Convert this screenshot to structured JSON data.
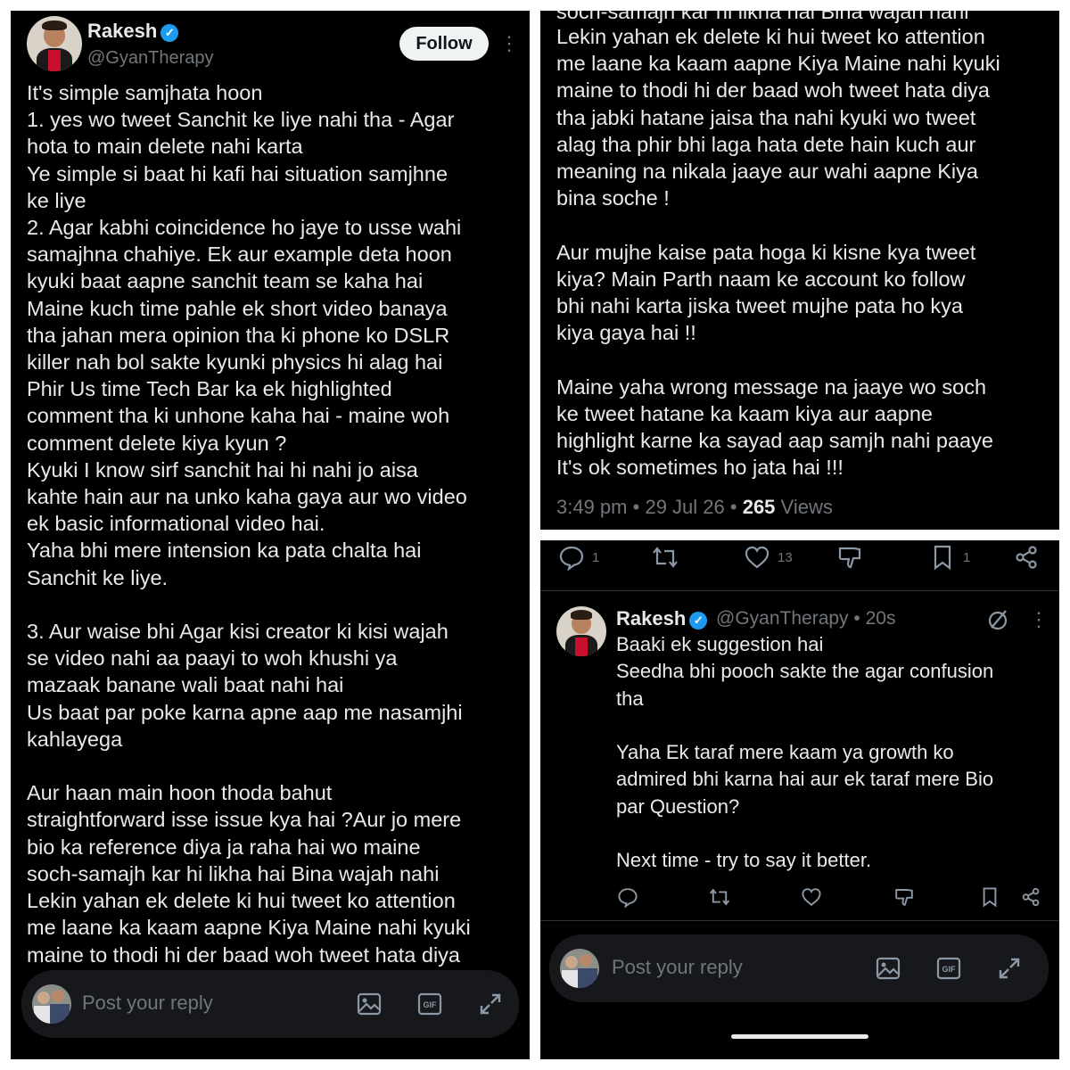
{
  "left_panel": {
    "author_name": "Rakesh",
    "author_handle": "@GyanTherapy",
    "follow_label": "Follow",
    "tweet_text": "It's simple samjhata hoon\n1. yes wo tweet Sanchit ke liye nahi tha - Agar\nhota to main delete nahi karta\nYe simple si baat hi kafi hai situation samjhne\nke liye\n2. Agar kabhi coincidence ho jaye to usse wahi\nsamajhna chahiye. Ek aur example deta hoon\nkyuki baat aapne sanchit team se kaha hai\nMaine kuch time pahle ek short video banaya\ntha jahan mera opinion tha ki phone ko DSLR\nkiller nah bol sakte kyunki physics hi alag hai\nPhir Us time Tech Bar ka ek highlighted\ncomment tha ki unhone kaha hai - maine woh\ncomment delete kiya kyun ?\nKyuki I know sirf sanchit hai hi nahi jo aisa\nkahte hain aur na unko kaha gaya aur wo video\nek basic informational video hai.\nYaha bhi mere intension ka pata chalta hai\nSanchit ke liye.\n\n3. Aur waise bhi Agar kisi creator ki kisi wajah\nse video nahi aa paayi to woh khushi ya\nmazaak banane wali baat nahi hai\nUs baat par poke karna apne aap me nasamjhi\nkahlayega\n\nAur haan main hoon thoda bahut\nstraightforward isse issue kya hai ?Aur jo mere\nbio ka reference diya ja raha hai wo maine\nsoch-samajh kar hi likha hai Bina wajah nahi\nLekin yahan ek delete ki hui tweet ko attention\nme laane ka kaam aapne Kiya Maine nahi kyuki\nmaine to thodi hi der baad woh tweet hata diya",
    "reply_placeholder": "Post your reply"
  },
  "top_right_panel": {
    "cut_line": "soch-samajh kar hi likha hai Bina wajah nahi",
    "tweet_text": "Lekin yahan ek delete ki hui tweet ko attention\nme laane ka kaam aapne Kiya Maine nahi kyuki\nmaine to thodi hi der baad woh tweet hata diya\ntha jabki hatane jaisa tha nahi kyuki wo tweet\nalag tha phir bhi laga hata dete hain kuch aur\nmeaning na nikala jaaye aur wahi aapne Kiya\nbina soche !\n\nAur mujhe kaise pata hoga ki kisne kya tweet\nkiya? Main Parth naam ke account ko follow\nbhi nahi karta jiska tweet mujhe pata ho kya\nkiya gaya hai !!\n\nMaine yaha wrong message na jaaye wo soch\nke tweet hatane ka kaam kiya aur aapne\nhighlight karne ka sayad aap samjh nahi paaye\nIt's ok sometimes ho jata hai !!!",
    "time": "3:49 pm",
    "date": "29 Jul 26",
    "views_count": "265",
    "views_label": "Views"
  },
  "bottom_right_panel": {
    "actions": {
      "replies": "1",
      "likes": "13",
      "bookmarks": "1"
    },
    "reply": {
      "author_name": "Rakesh",
      "author_handle": "@GyanTherapy",
      "age": "20s",
      "text": "Baaki ek suggestion hai\nSeedha bhi pooch sakte the agar confusion\ntha\n\nYaha Ek taraf mere kaam ya growth ko\nadmired bhi karna hai aur ek taraf mere Bio\npar Question?\n\nNext time - try to say it better."
    },
    "reply_placeholder": "Post your reply"
  },
  "icons": {
    "reply": "comment-icon",
    "repost": "repost-icon",
    "like": "heart-icon",
    "dislike": "dislike-icon",
    "bookmark": "bookmark-icon",
    "share": "share-icon",
    "image": "image-icon",
    "gif": "gif-icon",
    "expand": "expand-icon",
    "grok": "no-symbol-icon"
  },
  "colors": {
    "background": "#000000",
    "text": "#e7e9ea",
    "muted": "#71767b",
    "verified": "#1d9bf0"
  }
}
